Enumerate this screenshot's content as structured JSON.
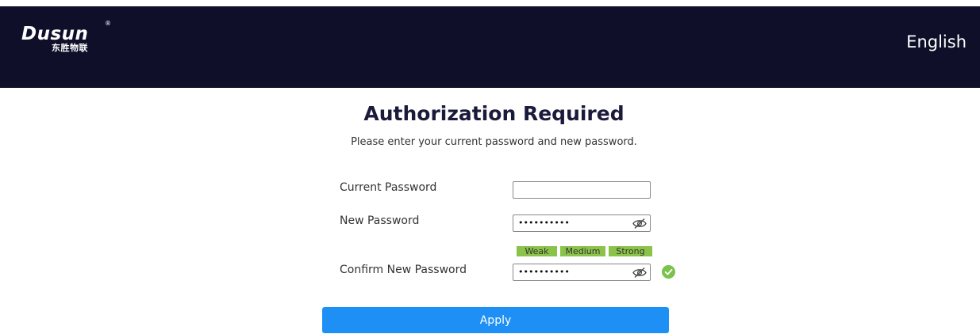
{
  "header": {
    "logo_text": "Dusun",
    "logo_registered": "®",
    "logo_subtext": "东胜物联",
    "language": "English"
  },
  "main": {
    "title": "Authorization Required",
    "subtitle": "Please enter your current password and new password."
  },
  "form": {
    "current_password": {
      "label": "Current Password",
      "value": ""
    },
    "new_password": {
      "label": "New Password",
      "value": "••••••••••"
    },
    "confirm_password": {
      "label": "Confirm New Password",
      "value": "••••••••••"
    },
    "strength": {
      "weak": "Weak",
      "medium": "Medium",
      "strong": "Strong",
      "active_color": "#8bc34a"
    },
    "match_icon": "check-circle-icon",
    "match_color": "#7cc24f",
    "apply_label": "Apply"
  },
  "colors": {
    "header_bg": "#0f0f2a",
    "apply_bg": "#1e90f5"
  }
}
